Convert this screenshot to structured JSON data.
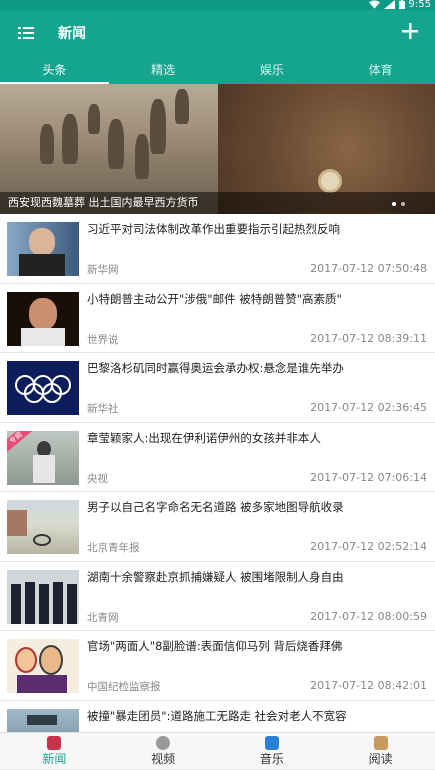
{
  "status": {
    "time": "9:55"
  },
  "appbar": {
    "title": "新闻"
  },
  "tabs": [
    "头条",
    "精选",
    "娱乐",
    "体育"
  ],
  "banner": {
    "caption": "西安现西魏墓葬 出土国内最早西方货币"
  },
  "news": [
    {
      "headline": "习近平对司法体制改革作出重要指示引起热烈反响",
      "source": "新华网",
      "time": "2017-07-12 07:50:48",
      "thumb": "portrait"
    },
    {
      "headline": "小特朗普主动公开\"涉俄\"邮件 被特朗普赞\"高素质\"",
      "source": "世界说",
      "time": "2017-07-12 08:39:11",
      "thumb": "portrait2"
    },
    {
      "headline": "巴黎洛杉矶同时赢得奥运会承办权:悬念是谁先举办",
      "source": "新华社",
      "time": "2017-07-12 02:36:45",
      "thumb": "olympic"
    },
    {
      "headline": "章莹颖家人:出现在伊利诺伊州的女孩并非本人",
      "source": "央视",
      "time": "2017-07-12 07:06:14",
      "thumb": "street",
      "ribbon": "专题"
    },
    {
      "headline": "男子以自己名字命名无名道路 被多家地图导航收录",
      "source": "北京青年报",
      "time": "2017-07-12 02:52:14",
      "thumb": "road"
    },
    {
      "headline": "湖南十余警察赴京抓捕嫌疑人 被围堵限制人身自由",
      "source": "北青网",
      "time": "2017-07-12 08:00:59",
      "thumb": "police"
    },
    {
      "headline": "官场\"两面人\"8副脸谱:表面信仰马列 背后烧香拜佛",
      "source": "中国纪检监察报",
      "time": "2017-07-12 08:42:01",
      "thumb": "cartoon"
    },
    {
      "headline": "被撞\"暴走团员\":道路施工无路走 社会对老人不宽容",
      "source": "",
      "time": "",
      "thumb": "crowd"
    }
  ],
  "bottomnav": [
    {
      "label": "新闻",
      "color": "#c8324a"
    },
    {
      "label": "视频",
      "color": "#888888"
    },
    {
      "label": "音乐",
      "color": "#2a7fd6"
    },
    {
      "label": "阅读",
      "color": "#c89a5a"
    }
  ],
  "colors": {
    "primary": "#15a58f",
    "statusbar": "#0d9a86"
  }
}
